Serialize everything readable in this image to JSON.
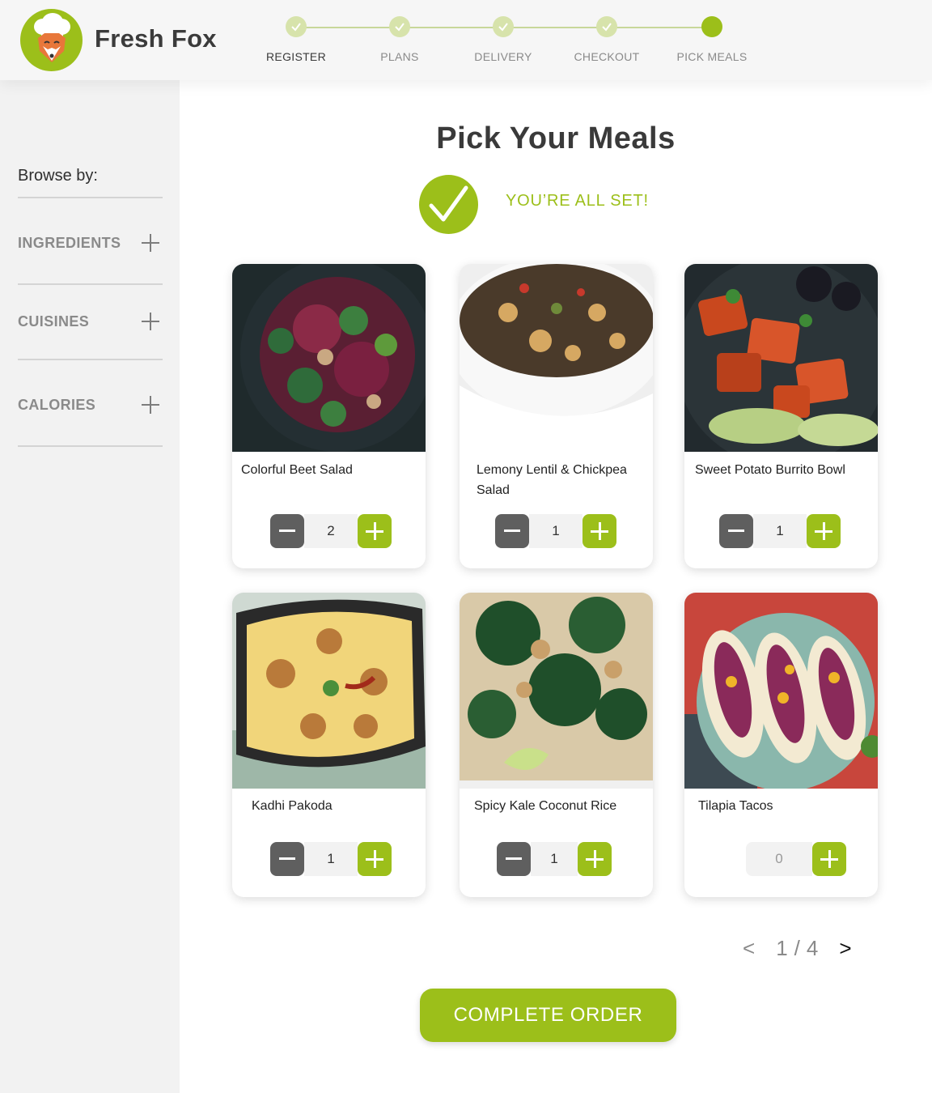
{
  "brand": {
    "name": "Fresh Fox",
    "logo_icon": "fox-chef-logo"
  },
  "steps": [
    {
      "label": "REGISTER",
      "state": "done"
    },
    {
      "label": "PLANS",
      "state": "done"
    },
    {
      "label": "DELIVERY",
      "state": "done"
    },
    {
      "label": "CHECKOUT",
      "state": "done"
    },
    {
      "label": "PICK MEALS",
      "state": "current"
    }
  ],
  "sidebar": {
    "browse_label": "Browse by:",
    "filters": [
      {
        "label": "INGREDIENTS",
        "icon": "plus-icon"
      },
      {
        "label": "CUISINES",
        "icon": "plus-icon"
      },
      {
        "label": "CALORIES",
        "icon": "plus-icon"
      }
    ]
  },
  "main": {
    "title": "Pick Your Meals",
    "status_text": "YOU’RE ALL SET!",
    "status_icon": "checkmark-icon"
  },
  "meals": [
    {
      "name": "Colorful Beet Salad",
      "quantity": "2"
    },
    {
      "name": "Lemony Lentil & Chickpea Salad",
      "quantity": "1"
    },
    {
      "name": "Sweet Potato Burrito Bowl",
      "quantity": "1"
    },
    {
      "name": "Kadhi Pakoda",
      "quantity": "1"
    },
    {
      "name": "Spicy Kale Coconut Rice",
      "quantity": "1"
    },
    {
      "name": "Tilapia Tacos",
      "quantity": "0"
    }
  ],
  "pagination": {
    "prev": "<",
    "current": "1",
    "separator": "/",
    "total": "4",
    "next": ">"
  },
  "cta": {
    "label": "COMPLETE ORDER"
  },
  "colors": {
    "accent": "#9cbf1a",
    "minus_button": "#5f5f5f",
    "sidebar_bg": "#f2f2f2"
  }
}
